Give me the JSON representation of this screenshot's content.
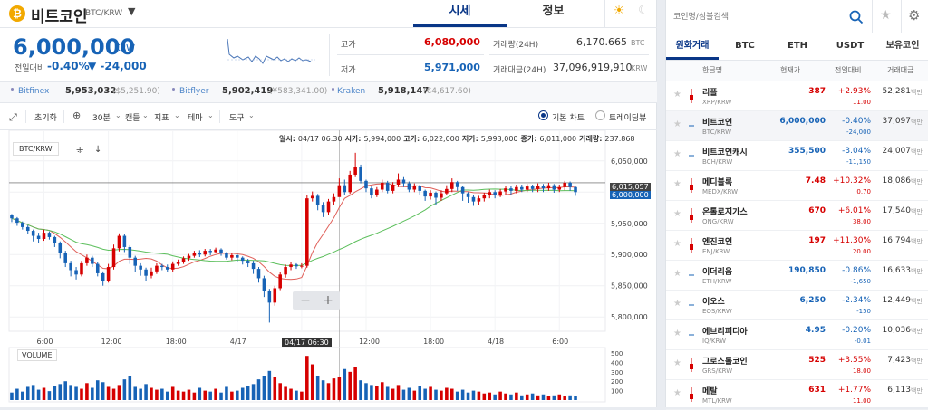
{
  "header": {
    "coin_name": "비트코인",
    "pair": "BTC/KRW",
    "tabs": [
      "시세",
      "정보"
    ],
    "active_tab": 0
  },
  "price": {
    "current": "6,000,000",
    "currency": "KRW",
    "change_label": "전일대비",
    "change_rate": "-0.40%",
    "change_amount": "▼ -24,000",
    "high_label": "고가",
    "high": "6,080,000",
    "low_label": "저가",
    "low": "5,971,000",
    "volume_label": "거래량(24H)",
    "volume": "6,170.665",
    "volume_unit": "BTC",
    "amount_label": "거래대금(24H)",
    "amount": "37,096,919,910",
    "amount_unit": "KRW"
  },
  "exchanges": [
    {
      "name": "Bitfinex",
      "price": "5,953,032",
      "usd": "($5,251.90)"
    },
    {
      "name": "Bitflyer",
      "price": "5,902,419",
      "usd": "(¥583,341.00)"
    },
    {
      "name": "Kraken",
      "price": "5,918,147",
      "usd": "(€4,617.60)"
    }
  ],
  "toolbar": {
    "reset": "초기화",
    "interval": "30분",
    "candle": "캔들",
    "indicator": "지표",
    "theme": "테마",
    "tools": "도구",
    "basic_chart": "기본 차트",
    "tradingview": "트레이딩뷰"
  },
  "chart": {
    "symbol": "BTC/KRW",
    "info_date_label": "일시:",
    "info_date": "04/17 06:30",
    "info_open_label": "시가:",
    "info_open": "5,994,000",
    "info_high_label": "고가:",
    "info_high": "6,022,000",
    "info_low_label": "저가:",
    "info_low": "5,993,000",
    "info_close_label": "종가:",
    "info_close": "6,011,000",
    "info_vol_label": "거래량:",
    "info_vol": "237.868",
    "y_ticks": [
      "6,050,000",
      "6,000,000",
      "5,950,000",
      "5,900,000",
      "5,850,000",
      "5,800,000"
    ],
    "x_ticks": [
      "6:00",
      "12:00",
      "18:00",
      "4/17",
      "6:00",
      "12:00",
      "18:00",
      "4/18",
      "6:00"
    ],
    "crosshair_label": "04/17 06:30",
    "last_price_1": "6,015,057",
    "last_price_2": "6,000,000",
    "volume_title": "VOLUME",
    "vol_ticks": [
      "500",
      "400",
      "300",
      "200",
      "100"
    ],
    "minus": "−",
    "plus": "+"
  },
  "colors": {
    "up": "#d60000",
    "down": "#1763b6",
    "ma_short": "#e0605a",
    "ma_long": "#5cbf5c",
    "accent": "#093687"
  },
  "chart_data": {
    "type": "candlestick",
    "candles": [
      [
        5964000,
        5958000,
        5965000,
        5952000
      ],
      [
        5958000,
        5951000,
        5960000,
        5946000
      ],
      [
        5951000,
        5944000,
        5953000,
        5940000
      ],
      [
        5944000,
        5938000,
        5947000,
        5933000
      ],
      [
        5938000,
        5930000,
        5940000,
        5921000
      ],
      [
        5930000,
        5925000,
        5935000,
        5918000
      ],
      [
        5925000,
        5935000,
        5940000,
        5922000
      ],
      [
        5935000,
        5928000,
        5937000,
        5924000
      ],
      [
        5928000,
        5918000,
        5930000,
        5912000
      ],
      [
        5918000,
        5902000,
        5921000,
        5894000
      ],
      [
        5902000,
        5886000,
        5906000,
        5880000
      ],
      [
        5886000,
        5875000,
        5890000,
        5865000
      ],
      [
        5875000,
        5868000,
        5880000,
        5860000
      ],
      [
        5868000,
        5886000,
        5890000,
        5865000
      ],
      [
        5886000,
        5895000,
        5900000,
        5882000
      ],
      [
        5895000,
        5885000,
        5898000,
        5880000
      ],
      [
        5885000,
        5870000,
        5888000,
        5865000
      ],
      [
        5870000,
        5858000,
        5873000,
        5850000
      ],
      [
        5858000,
        5880000,
        5885000,
        5855000
      ],
      [
        5880000,
        5910000,
        5916000,
        5876000
      ],
      [
        5910000,
        5930000,
        5934000,
        5905000
      ],
      [
        5930000,
        5912000,
        5933000,
        5904000
      ],
      [
        5912000,
        5895000,
        5915000,
        5885000
      ],
      [
        5895000,
        5882000,
        5898000,
        5872000
      ],
      [
        5882000,
        5876000,
        5886000,
        5866000
      ],
      [
        5876000,
        5866000,
        5879000,
        5857000
      ],
      [
        5866000,
        5873000,
        5879000,
        5862000
      ],
      [
        5873000,
        5882000,
        5886000,
        5869000
      ],
      [
        5882000,
        5880000,
        5885000,
        5875000
      ],
      [
        5880000,
        5876000,
        5884000,
        5872000
      ],
      [
        5876000,
        5885000,
        5889000,
        5872000
      ],
      [
        5885000,
        5888000,
        5892000,
        5882000
      ],
      [
        5888000,
        5894000,
        5897000,
        5885000
      ],
      [
        5894000,
        5898000,
        5901000,
        5890000
      ],
      [
        5898000,
        5903000,
        5906000,
        5895000
      ],
      [
        5903000,
        5900000,
        5907000,
        5896000
      ],
      [
        5900000,
        5906000,
        5909000,
        5897000
      ],
      [
        5906000,
        5904000,
        5909000,
        5899000
      ],
      [
        5904000,
        5908000,
        5911000,
        5902000
      ],
      [
        5908000,
        5902000,
        5910000,
        5898000
      ],
      [
        5902000,
        5895000,
        5904000,
        5892000
      ],
      [
        5895000,
        5899000,
        5902000,
        5891000
      ],
      [
        5899000,
        5895000,
        5901000,
        5888000
      ],
      [
        5895000,
        5890000,
        5897000,
        5884000
      ],
      [
        5890000,
        5886000,
        5893000,
        5880000
      ],
      [
        5886000,
        5877000,
        5890000,
        5869000
      ],
      [
        5877000,
        5862000,
        5880000,
        5855000
      ],
      [
        5862000,
        5842000,
        5866000,
        5832000
      ],
      [
        5842000,
        5823000,
        5845000,
        5791000
      ],
      [
        5823000,
        5846000,
        5850000,
        5818000
      ],
      [
        5846000,
        5868000,
        5872000,
        5843000
      ],
      [
        5868000,
        5880000,
        5884000,
        5863000
      ],
      [
        5880000,
        5884000,
        5888000,
        5875000
      ],
      [
        5884000,
        5881000,
        5886000,
        5877000
      ],
      [
        5881000,
        5882000,
        5886000,
        5878000
      ],
      [
        5882000,
        5990000,
        5996000,
        5879000
      ],
      [
        5990000,
        5994000,
        6001000,
        5985000
      ],
      [
        5994000,
        5980000,
        5997000,
        5971000
      ],
      [
        5980000,
        5968000,
        5984000,
        5960000
      ],
      [
        5968000,
        5985000,
        5989000,
        5964000
      ],
      [
        5985000,
        5992000,
        5998000,
        5980000
      ],
      [
        5992000,
        6011000,
        6022000,
        5993000
      ],
      [
        6011000,
        6000000,
        6020000,
        5996000
      ],
      [
        6000000,
        6028000,
        6034000,
        5997000
      ],
      [
        6028000,
        6040000,
        6063000,
        6024000
      ],
      [
        6040000,
        6018000,
        6044000,
        6014000
      ],
      [
        6018000,
        6006000,
        6020000,
        6000000
      ],
      [
        6006000,
        5996000,
        6009000,
        5990000
      ],
      [
        5996000,
        6004000,
        6008000,
        5992000
      ],
      [
        6004000,
        6015000,
        6020000,
        6000000
      ],
      [
        6015000,
        6002000,
        6018000,
        5998000
      ],
      [
        6002000,
        6012000,
        6016000,
        5998000
      ],
      [
        6012000,
        6020000,
        6030000,
        6008000
      ],
      [
        6020000,
        6014000,
        6024000,
        6008000
      ],
      [
        6014000,
        6004000,
        6017000,
        6000000
      ],
      [
        6004000,
        6010000,
        6014000,
        6000000
      ],
      [
        6010000,
        6002000,
        6012000,
        5996000
      ],
      [
        6002000,
        5993000,
        6004000,
        5986000
      ],
      [
        5993000,
        5999000,
        6003000,
        5988000
      ],
      [
        5999000,
        5991000,
        6001000,
        5980000
      ],
      [
        5991000,
        5998000,
        6003000,
        5986000
      ],
      [
        5998000,
        6005000,
        6011000,
        5995000
      ],
      [
        6005000,
        6016000,
        6022000,
        6000000
      ],
      [
        6016000,
        6008000,
        6018000,
        6002000
      ],
      [
        6008000,
        5998000,
        6010000,
        5986000
      ],
      [
        5998000,
        5992000,
        6000000,
        5983000
      ],
      [
        5992000,
        5985000,
        5995000,
        5978000
      ],
      [
        5985000,
        5990000,
        5994000,
        5980000
      ],
      [
        5990000,
        5995000,
        5999000,
        5985000
      ],
      [
        5995000,
        6000000,
        6004000,
        5990000
      ],
      [
        6000000,
        5996000,
        6003000,
        5990000
      ],
      [
        5996000,
        6001000,
        6005000,
        5992000
      ],
      [
        6001000,
        6006000,
        6010000,
        5996000
      ],
      [
        6006000,
        6002000,
        6010000,
        5996000
      ],
      [
        6002000,
        6008000,
        6012000,
        5998000
      ],
      [
        6008000,
        6004000,
        6012000,
        6000000
      ],
      [
        6004000,
        6009000,
        6013000,
        6000000
      ],
      [
        6009000,
        6005000,
        6012000,
        6000000
      ],
      [
        6005000,
        6010000,
        6014000,
        6000000
      ],
      [
        6010000,
        6006000,
        6013000,
        6000000
      ],
      [
        6006000,
        6011000,
        6015000,
        6002000
      ],
      [
        6011000,
        6004000,
        6013000,
        5999000
      ],
      [
        6004000,
        6008000,
        6012000,
        6000000
      ],
      [
        6008000,
        6015000,
        6018000,
        6003000
      ],
      [
        6015000,
        6008000,
        6017000,
        6002000
      ],
      [
        6008000,
        6000000,
        6010000,
        5994000
      ]
    ],
    "volume": [
      80,
      120,
      90,
      140,
      160,
      110,
      130,
      95,
      150,
      170,
      200,
      160,
      140,
      120,
      180,
      130,
      210,
      190,
      140,
      120,
      160,
      220,
      260,
      140,
      120,
      170,
      130,
      110,
      120,
      90,
      140,
      100,
      90,
      110,
      80,
      130,
      100,
      90,
      120,
      80,
      140,
      90,
      100,
      130,
      150,
      170,
      220,
      260,
      310,
      250,
      180,
      140,
      120,
      100,
      90,
      470,
      380,
      260,
      210,
      180,
      230,
      250,
      330,
      300,
      350,
      210,
      180,
      160,
      150,
      190,
      140,
      120,
      160,
      110,
      130,
      100,
      150,
      120,
      140,
      110,
      100,
      130,
      120,
      90,
      110,
      80,
      100,
      90,
      70,
      80,
      60,
      90,
      70,
      60,
      80,
      50,
      60,
      70,
      50,
      60,
      40,
      50,
      60,
      40,
      50,
      40
    ],
    "ylim": [
      5780000,
      6070000
    ],
    "vol_ylim": [
      0,
      520
    ]
  },
  "right": {
    "search_placeholder": "코인명/심볼검색",
    "tabs": [
      "원화거래",
      "BTC",
      "ETH",
      "USDT",
      "보유코인"
    ],
    "active_tab": 0,
    "col_name": "한글명",
    "col_price": "현재가",
    "col_change": "전일대비",
    "col_amount": "거래대금",
    "coins": [
      {
        "name": "리플",
        "sym": "XRP/KRW",
        "price": "387",
        "rate": "+2.93%",
        "diff": "11.00",
        "amount": "52,281",
        "unit": "백만",
        "dir": "up"
      },
      {
        "name": "비트코인",
        "sym": "BTC/KRW",
        "price": "6,000,000",
        "rate": "-0.40%",
        "diff": "-24,000",
        "amount": "37,097",
        "unit": "백만",
        "dir": "down"
      },
      {
        "name": "비트코인캐시",
        "sym": "BCH/KRW",
        "price": "355,500",
        "rate": "-3.04%",
        "diff": "-11,150",
        "amount": "24,007",
        "unit": "백만",
        "dir": "down"
      },
      {
        "name": "메디블록",
        "sym": "MEDX/KRW",
        "price": "7.48",
        "rate": "+10.32%",
        "diff": "0.70",
        "amount": "18,086",
        "unit": "백만",
        "dir": "up"
      },
      {
        "name": "온톨로지가스",
        "sym": "ONG/KRW",
        "price": "670",
        "rate": "+6.01%",
        "diff": "38.00",
        "amount": "17,540",
        "unit": "백만",
        "dir": "up"
      },
      {
        "name": "엔진코인",
        "sym": "ENJ/KRW",
        "price": "197",
        "rate": "+11.30%",
        "diff": "20.00",
        "amount": "16,794",
        "unit": "백만",
        "dir": "up"
      },
      {
        "name": "이더리움",
        "sym": "ETH/KRW",
        "price": "190,850",
        "rate": "-0.86%",
        "diff": "-1,650",
        "amount": "16,633",
        "unit": "백만",
        "dir": "down"
      },
      {
        "name": "이오스",
        "sym": "EOS/KRW",
        "price": "6,250",
        "rate": "-2.34%",
        "diff": "-150",
        "amount": "12,449",
        "unit": "백만",
        "dir": "down"
      },
      {
        "name": "에브리피디아",
        "sym": "IQ/KRW",
        "price": "4.95",
        "rate": "-0.20%",
        "diff": "-0.01",
        "amount": "10,036",
        "unit": "백만",
        "dir": "down"
      },
      {
        "name": "그로스톨코인",
        "sym": "GRS/KRW",
        "price": "525",
        "rate": "+3.55%",
        "diff": "18.00",
        "amount": "7,423",
        "unit": "백만",
        "dir": "up"
      },
      {
        "name": "메탈",
        "sym": "MTL/KRW",
        "price": "631",
        "rate": "+1.77%",
        "diff": "11.00",
        "amount": "6,113",
        "unit": "백만",
        "dir": "up"
      }
    ]
  }
}
